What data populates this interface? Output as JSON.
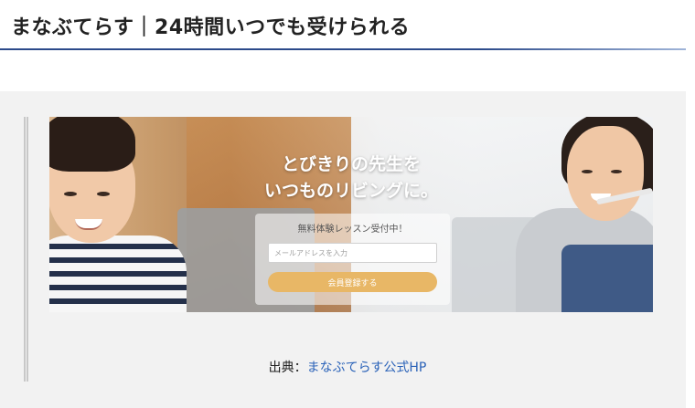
{
  "heading": {
    "title": "まなぶてらす｜24時間いつでも受けられる"
  },
  "banner": {
    "headline_line1": "とびきりの先生を",
    "headline_line2": "いつものリビングに。",
    "signup": {
      "heading": "無料体験レッスン受付中！",
      "email_placeholder": "メールアドレスを入力",
      "register_label": "会員登録する"
    }
  },
  "citation": {
    "prefix": "出典：",
    "link_text": "まなぶてらす公式HP"
  },
  "colors": {
    "heading_rule": "#2c4a8a",
    "quote_background": "#f2f2f2",
    "button": "#e8b766",
    "link": "#2a62b8"
  }
}
